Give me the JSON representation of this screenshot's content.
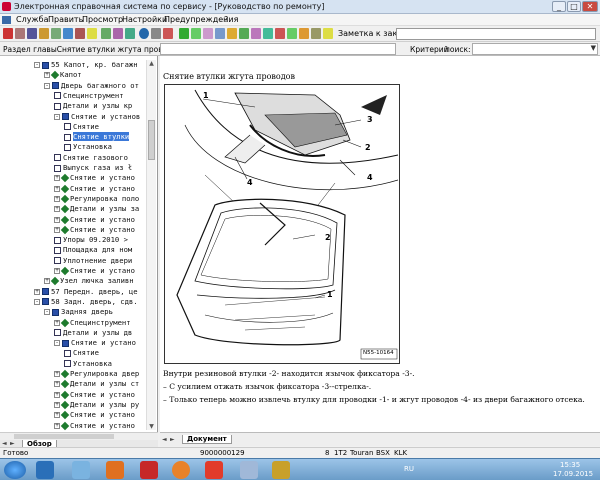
{
  "window": {
    "title": "Электронная справочная система по сервису - [Руководство по ремонту]",
    "min_label": "_",
    "max_label": "□",
    "close_label": "✕"
  },
  "menu": {
    "items": [
      "Служба",
      "Править",
      "Просмотр",
      "Настройки",
      "Предупреждения",
      "?"
    ]
  },
  "toolbar": {
    "order_label": "Заметка к заказу:"
  },
  "addrbar": {
    "path": "Раздел главыСнятие втулки жгута проводов",
    "criteria_label": "Критерий",
    "search_label": "поиск:"
  },
  "tree": {
    "items": [
      {
        "label": "55 Капот, кр. багажн",
        "indent": 4,
        "type": "book",
        "pm": "-"
      },
      {
        "label": "Капот",
        "indent": 14,
        "type": "grp",
        "pm": "+"
      },
      {
        "label": "Дверь багажного от",
        "indent": 14,
        "type": "book",
        "pm": "-"
      },
      {
        "label": "Специнструмент",
        "indent": 24,
        "type": "doc",
        "pm": ""
      },
      {
        "label": "Детали и узлы кр",
        "indent": 24,
        "type": "doc",
        "pm": ""
      },
      {
        "label": "Снятие и установ",
        "indent": 24,
        "type": "book",
        "pm": "-"
      },
      {
        "label": "Снятие",
        "indent": 34,
        "type": "doc",
        "pm": ""
      },
      {
        "label": "Снятие втулки",
        "indent": 34,
        "type": "doc",
        "pm": "",
        "selected": true
      },
      {
        "label": "Установка",
        "indent": 34,
        "type": "doc",
        "pm": ""
      },
      {
        "label": "Снятие газового",
        "indent": 24,
        "type": "doc",
        "pm": ""
      },
      {
        "label": "Выпуск газа из ł",
        "indent": 24,
        "type": "doc",
        "pm": ""
      },
      {
        "label": "Снятие и устано",
        "indent": 24,
        "type": "grp",
        "pm": "+"
      },
      {
        "label": "Снятие и устано",
        "indent": 24,
        "type": "grp",
        "pm": "+"
      },
      {
        "label": "Регулировка поло",
        "indent": 24,
        "type": "grp",
        "pm": "+"
      },
      {
        "label": "Детали и узлы за",
        "indent": 24,
        "type": "grp",
        "pm": "+"
      },
      {
        "label": "Снятие и устано",
        "indent": 24,
        "type": "grp",
        "pm": "+"
      },
      {
        "label": "Снятие и устано",
        "indent": 24,
        "type": "grp",
        "pm": "+"
      },
      {
        "label": "Упоры 09.2010 >",
        "indent": 24,
        "type": "doc",
        "pm": ""
      },
      {
        "label": "Площадка для ном",
        "indent": 24,
        "type": "doc",
        "pm": ""
      },
      {
        "label": "Уплотнение двери",
        "indent": 24,
        "type": "doc",
        "pm": ""
      },
      {
        "label": "Снятие и устано",
        "indent": 24,
        "type": "grp",
        "pm": "+"
      },
      {
        "label": "Узел лючка заливн",
        "indent": 14,
        "type": "grp",
        "pm": "+"
      },
      {
        "label": "57 Передн. дверь, це",
        "indent": 4,
        "type": "book",
        "pm": "+"
      },
      {
        "label": "58 Задн. дверь, сдв.",
        "indent": 4,
        "type": "book",
        "pm": "-"
      },
      {
        "label": "Задняя дверь",
        "indent": 14,
        "type": "book",
        "pm": "-"
      },
      {
        "label": "Специнструмент",
        "indent": 24,
        "type": "grp",
        "pm": "+"
      },
      {
        "label": "Детали и узлы дв",
        "indent": 24,
        "type": "doc",
        "pm": ""
      },
      {
        "label": "Снятие и устано",
        "indent": 24,
        "type": "book",
        "pm": "-"
      },
      {
        "label": "Снятие",
        "indent": 34,
        "type": "doc",
        "pm": ""
      },
      {
        "label": "Установка",
        "indent": 34,
        "type": "doc",
        "pm": ""
      },
      {
        "label": "Регулировка двер",
        "indent": 24,
        "type": "grp",
        "pm": "+"
      },
      {
        "label": "Детали и узлы ст",
        "indent": 24,
        "type": "grp",
        "pm": "+"
      },
      {
        "label": "Снятие и устано",
        "indent": 24,
        "type": "grp",
        "pm": "+"
      },
      {
        "label": "Детали и узлы ру",
        "indent": 24,
        "type": "grp",
        "pm": "+"
      },
      {
        "label": "Снятие и устано",
        "indent": 24,
        "type": "grp",
        "pm": "+"
      },
      {
        "label": "Снятие и устано",
        "indent": 24,
        "type": "grp",
        "pm": "+"
      }
    ]
  },
  "sidebar_tab": "Обзор",
  "document": {
    "title": "Снятие втулки жгута проводов",
    "figure_code": "N55-10164",
    "callouts": [
      "1",
      "2",
      "3",
      "4",
      "2",
      "1",
      "4"
    ],
    "paragraphs": [
      "Внутри резиновой втулки -2- находится язычок фиксатора -3-.",
      "–  С усилием отжать язычок фиксатора -3--стрелка-.",
      "–  Только теперь можно извлечь втулку для проводки -1- и жгут проводов -4- из двери багажного отсека."
    ],
    "tab_label": "Документ"
  },
  "status": {
    "left": "Готово",
    "code": "9000000129",
    "num": "8",
    "engine": "1T2",
    "model": "Touran",
    "c1": "BSX",
    "c2": "KLK"
  },
  "taskbar": {
    "lang": "RU",
    "time": "15:35",
    "date": "17.09.2015"
  }
}
